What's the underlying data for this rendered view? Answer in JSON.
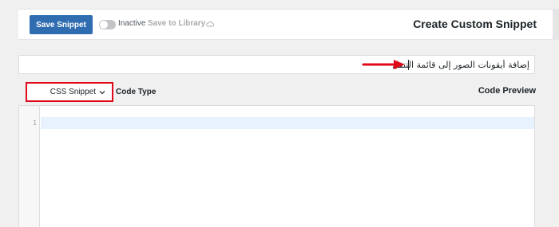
{
  "header": {
    "save_button": "Save Snippet",
    "toggle_label": "Inactive",
    "library_link": "Save to Library",
    "page_title": "Create Custom Snippet"
  },
  "snippet": {
    "title_value": "إضافة أيقونات الصور إلى قائمة التنقل"
  },
  "code_type": {
    "selected": "CSS Snippet",
    "label": "Code Type",
    "preview_label": "Code Preview"
  },
  "editor": {
    "line_numbers": [
      "1"
    ]
  },
  "colors": {
    "primary": "#2f6cb0",
    "highlight": "#e0091a",
    "active_line": "#e8f2ff"
  },
  "toggle_state": "off"
}
